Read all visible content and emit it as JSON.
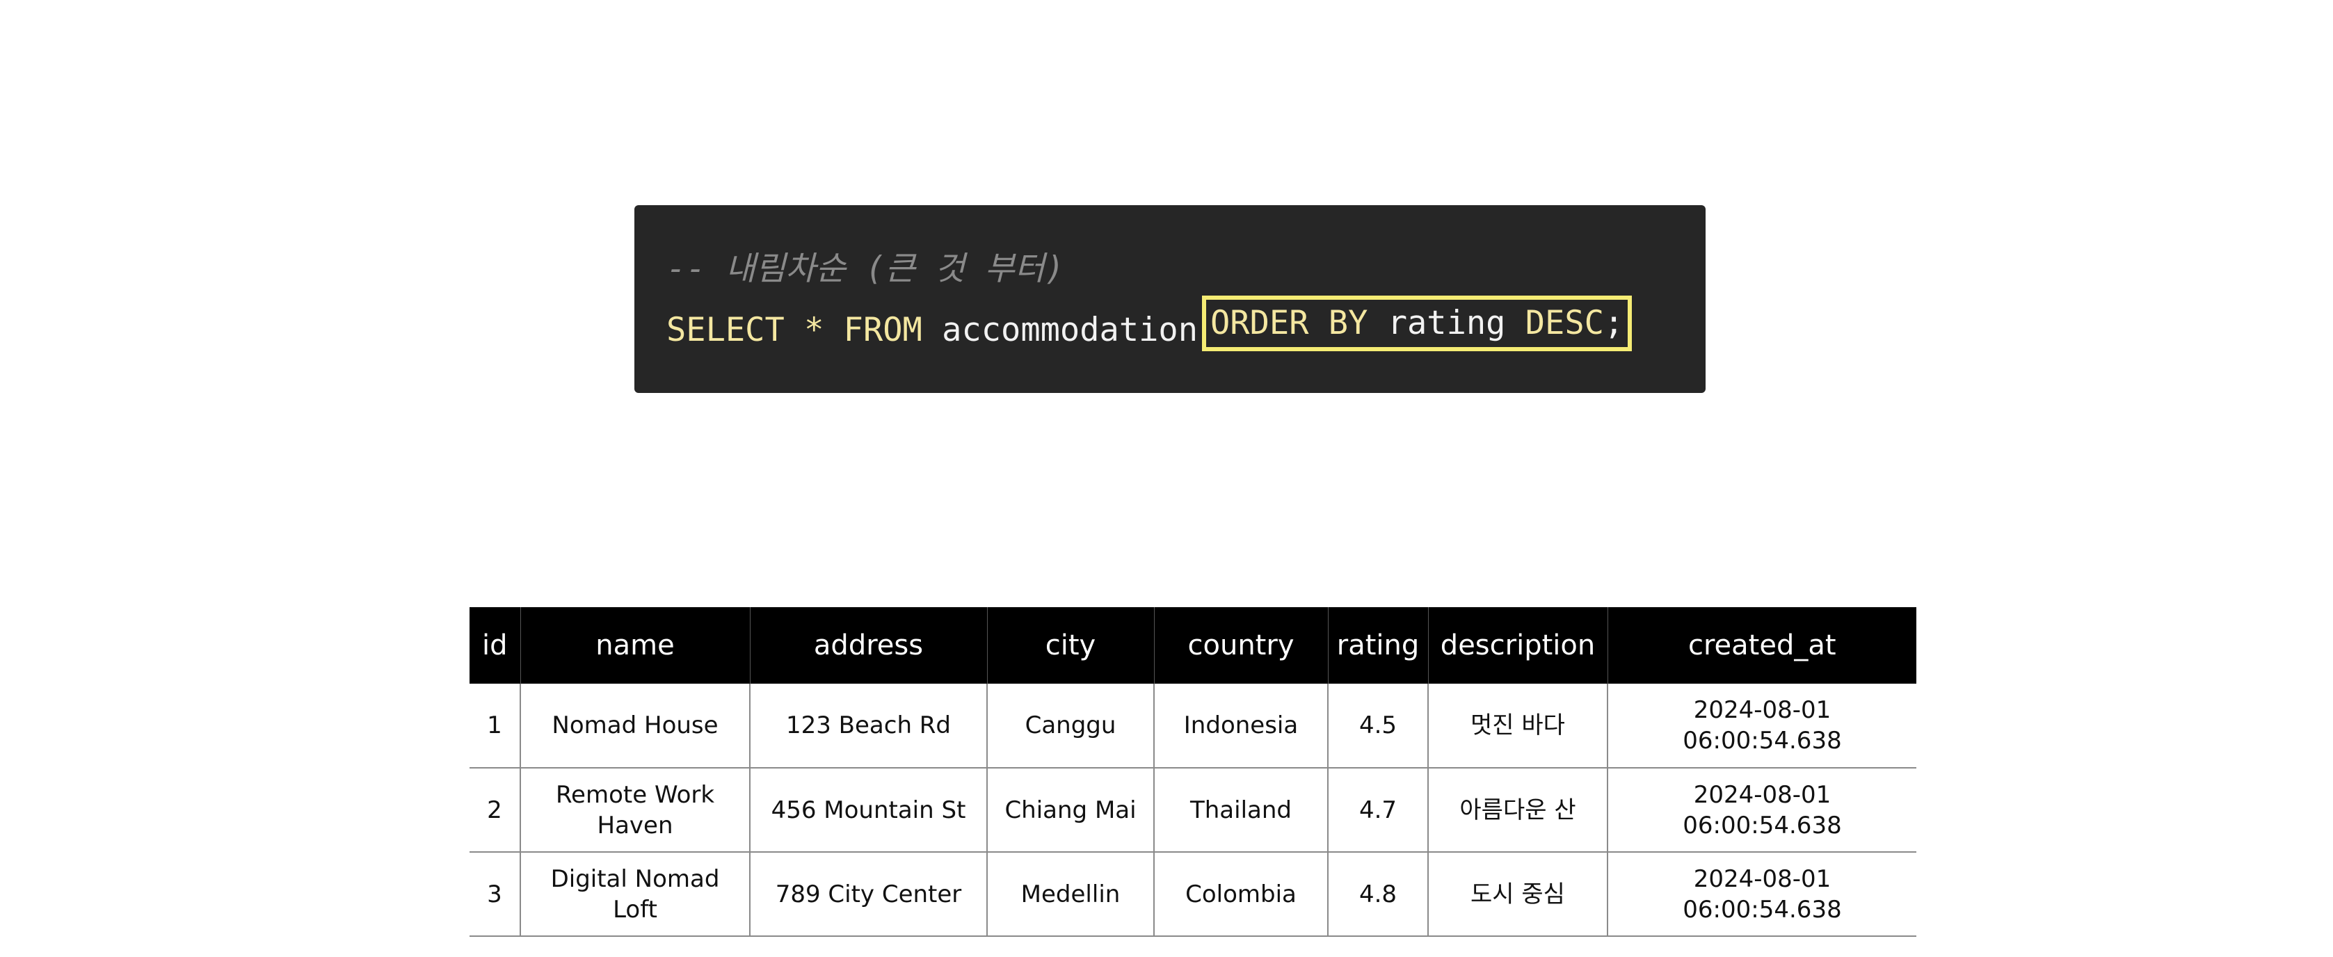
{
  "code": {
    "comment": "-- 내림차순 (큰 것 부터)",
    "select_kw": "SELECT",
    "star": "*",
    "from_kw": "FROM",
    "table_name": "accommodation",
    "order_by_kw": "ORDER BY",
    "order_column": "rating",
    "desc_kw": "DESC",
    "terminator": ";"
  },
  "table": {
    "headers": [
      "id",
      "name",
      "address",
      "city",
      "country",
      "rating",
      "description",
      "created_at"
    ],
    "rows": [
      [
        "1",
        "Nomad House",
        "123 Beach Rd",
        "Canggu",
        "Indonesia",
        "4.5",
        "멋진 바다",
        "2024-08-01 06:00:54.638"
      ],
      [
        "2",
        "Remote Work Haven",
        "456 Mountain St",
        "Chiang Mai",
        "Thailand",
        "4.7",
        "아름다운 산",
        "2024-08-01 06:00:54.638"
      ],
      [
        "3",
        "Digital Nomad Loft",
        "789 City Center",
        "Medellin",
        "Colombia",
        "4.8",
        "도시 중심",
        "2024-08-01 06:00:54.638"
      ]
    ]
  },
  "colors": {
    "code_background": "#262626",
    "keyword": "#f4e7a1",
    "highlight_border": "#f5ec74",
    "header_background": "#000000"
  }
}
